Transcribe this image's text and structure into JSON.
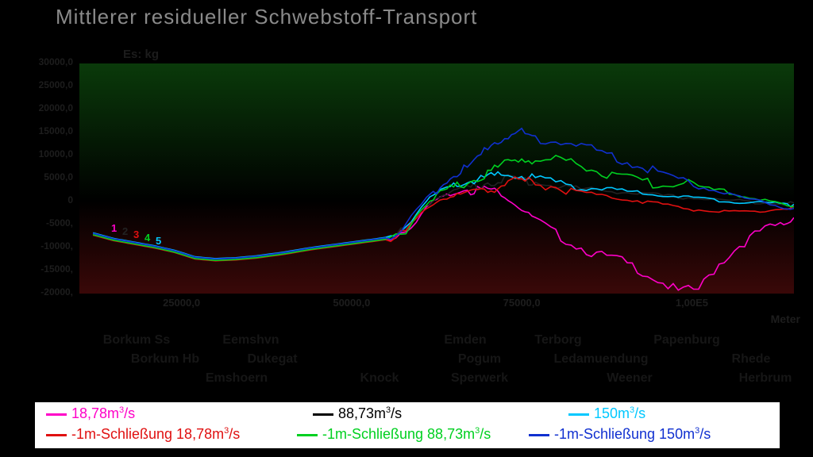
{
  "title": "Mittlerer residueller Schwebstoff-Transport",
  "unit_label": "Es: kg",
  "xlabel": "Meter",
  "y_ticks": [
    30000.0,
    25000.0,
    20000.0,
    15000.0,
    10000.0,
    5000.0,
    0,
    -5000.0,
    -10000.0,
    -15000.0,
    -20000.0
  ],
  "y_tick_labels": [
    "30000,0",
    "25000,0",
    "20000,0",
    "15000,0",
    "10000,0",
    "5000,0",
    "0",
    "-5000,",
    "-10000,",
    "-15000,",
    "-20000,"
  ],
  "x_ticks": [
    25000.0,
    50000.0,
    75000.0,
    100000.0
  ],
  "x_tick_labels": [
    "25000,0",
    "50000,0",
    "75000,0",
    "1,00E5"
  ],
  "city_labels": [
    {
      "t": "Borkum Ss",
      "x": 0.08,
      "row": 0
    },
    {
      "t": "Borkum Hb",
      "x": 0.12,
      "row": 1
    },
    {
      "t": "Eemshvn",
      "x": 0.24,
      "row": 0
    },
    {
      "t": "Dukegat",
      "x": 0.27,
      "row": 1
    },
    {
      "t": "Emshoern",
      "x": 0.22,
      "row": 2
    },
    {
      "t": "Knock",
      "x": 0.42,
      "row": 2
    },
    {
      "t": "Emden",
      "x": 0.54,
      "row": 0
    },
    {
      "t": "Pogum",
      "x": 0.56,
      "row": 1
    },
    {
      "t": "Sperwerk",
      "x": 0.56,
      "row": 2
    },
    {
      "t": "Terborg",
      "x": 0.67,
      "row": 0
    },
    {
      "t": "Ledamuendung",
      "x": 0.73,
      "row": 1
    },
    {
      "t": "Weener",
      "x": 0.77,
      "row": 2
    },
    {
      "t": "Papenburg",
      "x": 0.85,
      "row": 0
    },
    {
      "t": "Rhede",
      "x": 0.94,
      "row": 1
    },
    {
      "t": "Herbrum",
      "x": 0.96,
      "row": 2
    }
  ],
  "legend": [
    {
      "label": "18,78m³/s",
      "color": "#ff00c8"
    },
    {
      "label": "88,73m³/s",
      "color": "#000000"
    },
    {
      "label": "150m³/s",
      "color": "#00c8ff"
    },
    {
      "label": "-1m-Schließung 18,78m³/s",
      "color": "#e01010"
    },
    {
      "label": "-1m-Schließung 88,73m³/s",
      "color": "#00d020"
    },
    {
      "label": "-1m-Schließung 150m³/s",
      "color": "#1030d0"
    }
  ],
  "series_start_labels": [
    "1",
    "2",
    "3",
    "4",
    "5"
  ],
  "chart_data": {
    "type": "line",
    "xlabel": "Meter",
    "ylabel": "Es: kg",
    "xlim": [
      10000,
      115000
    ],
    "ylim": [
      -20000,
      30000
    ],
    "x": [
      12000,
      15000,
      18000,
      21000,
      24000,
      27000,
      30000,
      33000,
      36000,
      40000,
      44000,
      48000,
      52000,
      55000,
      58000,
      61000,
      63000,
      65000,
      67000,
      69000,
      71000,
      73000,
      75000,
      77000,
      80000,
      83000,
      86000,
      89000,
      92000,
      95000,
      98000,
      101000,
      104000,
      107000,
      110000,
      113000,
      115000
    ],
    "series": [
      {
        "name": "18,78m³/s",
        "color": "#ff00c8",
        "values": [
          -7000,
          -8200,
          -9000,
          -9800,
          -10800,
          -12200,
          -12600,
          -12400,
          -12000,
          -11200,
          -10200,
          -9400,
          -8600,
          -8000,
          -5500,
          -1000,
          1200,
          2000,
          3000,
          3200,
          2800,
          800,
          -1500,
          -3500,
          -6500,
          -9000,
          -11000,
          -12000,
          -14000,
          -16500,
          -19000,
          -18500,
          -13000,
          -9000,
          -6000,
          -4500,
          -3500
        ]
      },
      {
        "name": "88,73m³/s",
        "color": "#222222",
        "values": [
          -7100,
          -8300,
          -9100,
          -9900,
          -10900,
          -12300,
          -12700,
          -12500,
          -12100,
          -11300,
          -10300,
          -9500,
          -8700,
          -8100,
          -5600,
          -800,
          1500,
          2500,
          3500,
          4200,
          5000,
          5500,
          5200,
          4800,
          4000,
          3300,
          2800,
          2300,
          2000,
          1600,
          1200,
          900,
          600,
          300,
          100,
          -100,
          -300
        ]
      },
      {
        "name": "150m³/s",
        "color": "#00c8ff",
        "values": [
          -6800,
          -8000,
          -8800,
          -9600,
          -10600,
          -12000,
          -12400,
          -12200,
          -11800,
          -11000,
          -10000,
          -9200,
          -8400,
          -7800,
          -4800,
          300,
          2500,
          3800,
          4800,
          5500,
          6000,
          6200,
          6000,
          5600,
          4800,
          4000,
          3300,
          2700,
          2200,
          1800,
          1300,
          900,
          500,
          200,
          0,
          -300,
          -600
        ]
      },
      {
        "name": "-1m-Schließung 18,78m³/s",
        "color": "#e01010",
        "values": [
          -7300,
          -8500,
          -9300,
          -10100,
          -11100,
          -12500,
          -12900,
          -12700,
          -12300,
          -11500,
          -10500,
          -9700,
          -8900,
          -8300,
          -5900,
          -1500,
          600,
          1400,
          2200,
          2800,
          3600,
          4700,
          5000,
          4600,
          3600,
          2600,
          1600,
          1000,
          400,
          -200,
          -1000,
          -1600,
          -2000,
          -2200,
          -2000,
          -1400,
          -1000
        ]
      },
      {
        "name": "-1m-Schließung 88,73m³/s",
        "color": "#00d020",
        "values": [
          -7200,
          -8400,
          -9200,
          -10000,
          -11000,
          -12400,
          -12800,
          -12600,
          -12200,
          -11400,
          -10400,
          -9600,
          -8800,
          -8200,
          -5400,
          -300,
          2200,
          3500,
          4800,
          6000,
          7500,
          9500,
          10000,
          9000,
          9800,
          9000,
          7200,
          6000,
          5000,
          4200,
          4800,
          3800,
          2800,
          1600,
          600,
          -300,
          -1200
        ]
      },
      {
        "name": "-1m-Schließung 150m³/s",
        "color": "#1030d0",
        "values": [
          -6900,
          -8100,
          -8900,
          -9700,
          -10700,
          -12100,
          -12500,
          -12300,
          -11900,
          -11100,
          -10100,
          -9300,
          -8500,
          -7900,
          -4600,
          1000,
          3800,
          6000,
          8000,
          10500,
          13500,
          15000,
          15500,
          14000,
          14000,
          13000,
          11500,
          10000,
          8500,
          7000,
          5500,
          4000,
          2500,
          1200,
          200,
          -800,
          -1500
        ]
      }
    ]
  }
}
